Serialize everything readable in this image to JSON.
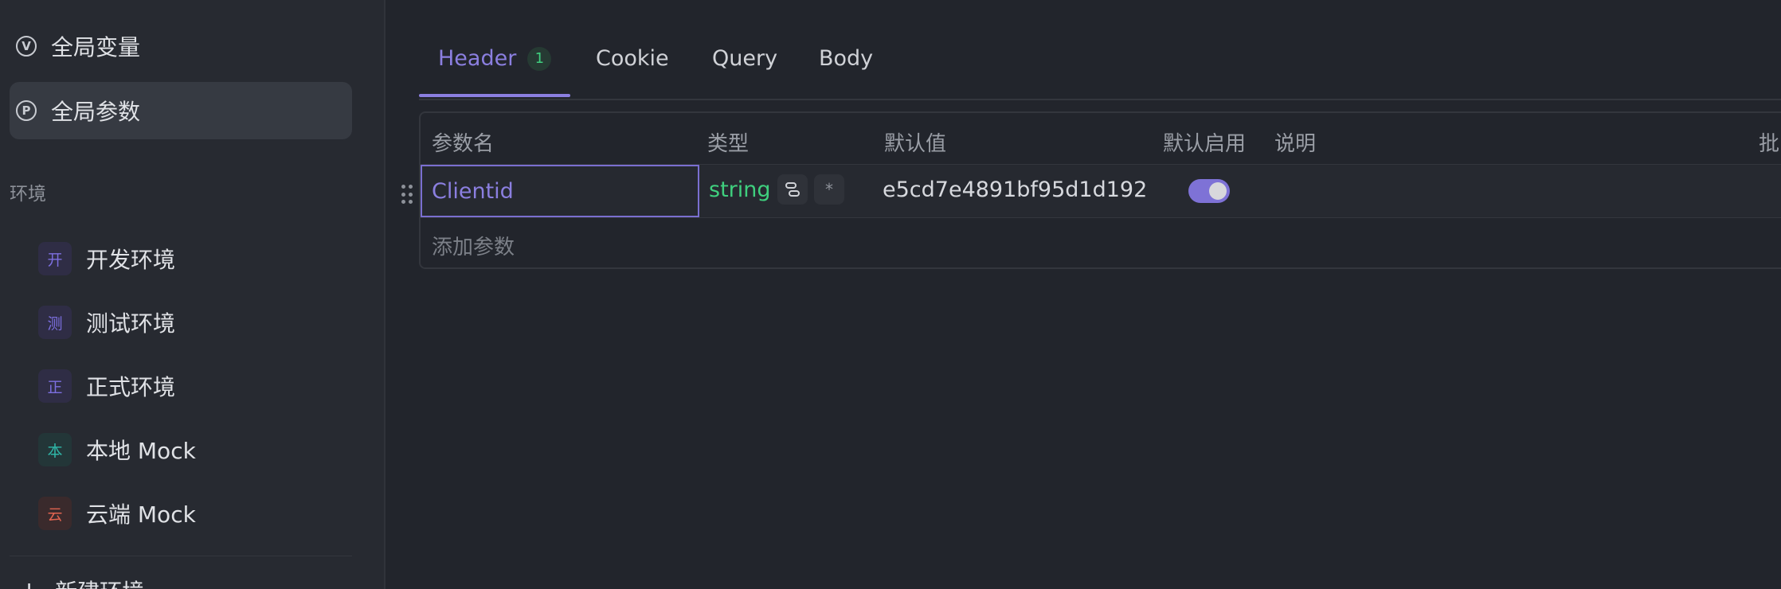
{
  "sidebar": {
    "global_vars_icon_letter": "V",
    "global_vars_label": "全局变量",
    "global_params_icon_letter": "P",
    "global_params_label": "全局参数",
    "env_section_label": "环境",
    "environments": [
      {
        "badge": "开",
        "label": "开发环境",
        "badge_color": "#7c6fe0",
        "badge_bg": "#2f2d45"
      },
      {
        "badge": "测",
        "label": "测试环境",
        "badge_color": "#7c6fe0",
        "badge_bg": "#2f2d45"
      },
      {
        "badge": "正",
        "label": "正式环境",
        "badge_color": "#7c6fe0",
        "badge_bg": "#2f2d45"
      },
      {
        "badge": "本",
        "label": "本地 Mock",
        "badge_color": "#2fb6a8",
        "badge_bg": "#233638"
      },
      {
        "badge": "云",
        "label": "云端 Mock",
        "badge_color": "#e0634f",
        "badge_bg": "#3a2a2c"
      }
    ],
    "new_env_label": "新建环境"
  },
  "tabs": [
    {
      "label": "Header",
      "count": "1"
    },
    {
      "label": "Cookie"
    },
    {
      "label": "Query"
    },
    {
      "label": "Body"
    }
  ],
  "table": {
    "headers": {
      "name": "参数名",
      "type": "类型",
      "default": "默认值",
      "enabled": "默认启用",
      "desc": "说明",
      "batch": "批"
    },
    "row": {
      "name": "Clientid",
      "type": "string",
      "default_value": "e5cd7e4891bf95d1d192",
      "enabled": true,
      "required_mark": "*"
    },
    "add_placeholder": "添加参数"
  },
  "colors": {
    "accent": "#8b7fe0",
    "success": "#3fcf7e",
    "background": "#22252c",
    "sidebar": "#272a31"
  }
}
